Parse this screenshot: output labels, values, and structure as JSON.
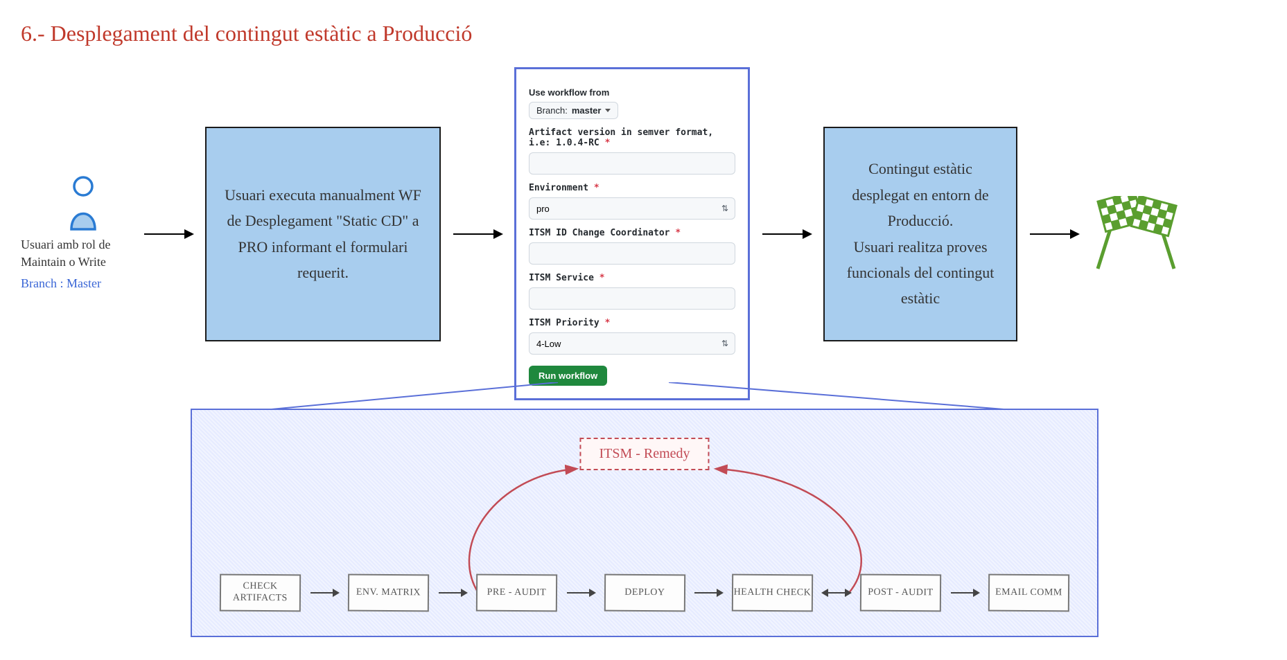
{
  "title": "6.- Desplegament del contingut estàtic a Producció",
  "user": {
    "role": "Usuari amb rol de Maintain o Write",
    "branch": "Branch : Master"
  },
  "box1": "Usuari executa manualment WF de Desplegament \"Static CD\" a PRO informant el formulari requerit.",
  "form": {
    "use_workflow_label": "Use workflow from",
    "branch_prefix": "Branch:",
    "branch_value": "master",
    "artifact_label": "Artifact version in semver format, i.e: 1.0.4-RC",
    "environment_label": "Environment",
    "environment_value": "pro",
    "itsm_id_label": "ITSM ID Change Coordinator",
    "itsm_service_label": "ITSM Service",
    "itsm_priority_label": "ITSM Priority",
    "itsm_priority_value": "4-Low",
    "run_label": "Run workflow"
  },
  "box3": "Contingut estàtic desplegat en entorn de Producció.\nUsuari realitza proves funcionals del contingut estàtic",
  "pipeline": {
    "itsm_label": "ITSM - Remedy",
    "steps": [
      "CHECK ARTIFACTS",
      "ENV. MATRIX",
      "PRE - AUDIT",
      "DEPLOY",
      "HEALTH CHECK",
      "POST - AUDIT",
      "EMAIL COMM"
    ]
  }
}
